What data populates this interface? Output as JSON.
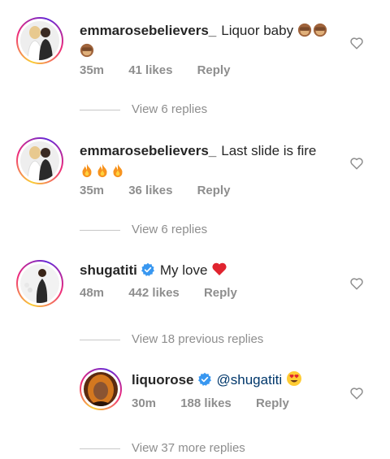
{
  "comments": [
    {
      "username": "emmarosebelievers_",
      "text": "Liquor baby",
      "text_emojis": [
        "see-no-evil-monkey",
        "see-no-evil-monkey",
        "see-no-evil-monkey"
      ],
      "time": "35m",
      "likes": "41 likes",
      "reply": "Reply",
      "view_replies": "View 6 replies"
    },
    {
      "username": "emmarosebelievers_",
      "text": "Last slide is fire",
      "text_emojis": [
        "fire",
        "fire",
        "fire"
      ],
      "time": "35m",
      "likes": "36 likes",
      "reply": "Reply",
      "view_replies": "View 6 replies"
    },
    {
      "username": "shugatiti",
      "verified": true,
      "text": "My love",
      "text_emojis": [
        "red-heart"
      ],
      "time": "48m",
      "likes": "442 likes",
      "reply": "Reply",
      "view_replies": "View 18 previous replies"
    }
  ],
  "reply": {
    "username": "liquorose",
    "verified": true,
    "mention": "@shugatiti",
    "text_emojis": [
      "heart-eyes-face"
    ],
    "time": "30m",
    "likes": "188 likes",
    "reply": "Reply"
  },
  "more_replies": "View 37 more replies",
  "colors": {
    "text": "#262626",
    "meta": "#8e8e8e",
    "verified_blue": "#3897f0",
    "mention": "#00376b"
  }
}
